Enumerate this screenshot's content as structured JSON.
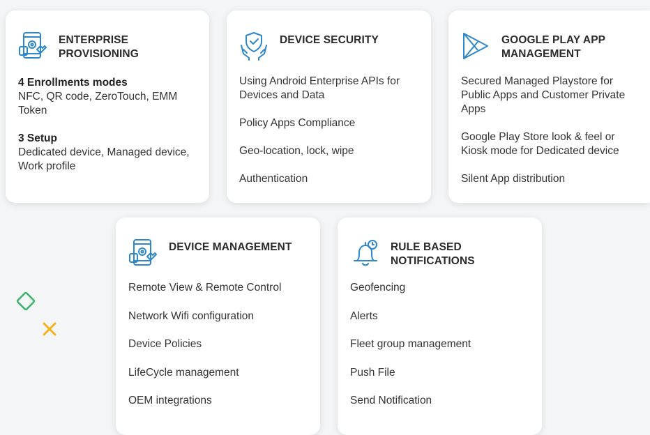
{
  "cards": {
    "enterprise": {
      "title_line1": "ENTERPRISE",
      "title_line2": "PROVISIONING",
      "groups": [
        {
          "title": "4 Enrollments modes",
          "line1": "NFC, QR code, ZeroTouch, EMM",
          "line2": "Token"
        },
        {
          "title": "3 Setup",
          "line1": "Dedicated device, Managed device,",
          "line2": "Work profile"
        }
      ]
    },
    "security": {
      "title": "DEVICE SECURITY",
      "items": [
        {
          "line1": "Using Android Enterprise APIs for",
          "line2": "Devices and Data"
        },
        {
          "line1": "Policy Apps Compliance"
        },
        {
          "line1": "Geo-location, lock, wipe"
        },
        {
          "line1": "Authentication"
        }
      ]
    },
    "playstore": {
      "title_line1": "GOOGLE PLAY APP",
      "title_line2": "MANAGEMENT",
      "items": [
        {
          "line1": "Secured Managed Playstore for",
          "line2": "Public Apps and Customer Private",
          "line3": "Apps"
        },
        {
          "line1": "Google Play Store look & feel or",
          "line2": "Kiosk mode for Dedicated device"
        },
        {
          "line1": "Silent App distribution"
        }
      ]
    },
    "management": {
      "title": "DEVICE MANAGEMENT",
      "items": [
        "Remote View & Remote Control",
        "Network Wifi configuration",
        "Device Policies",
        "LifeCycle management",
        "OEM integrations"
      ]
    },
    "notifications": {
      "title_line1": "RULE BASED",
      "title_line2": "NOTIFICATIONS",
      "items": [
        "Geofencing",
        "Alerts",
        "Fleet group management",
        "Push File",
        "Send Notification"
      ]
    }
  },
  "icons": {
    "enterprise": "device-settings-icon",
    "security": "shield-hands-icon",
    "playstore": "play-store-icon",
    "management": "device-settings-icon",
    "notifications": "bell-clock-icon"
  },
  "colors": {
    "icon_blue": "#2f86c9",
    "deco_green": "#3bb36a",
    "deco_yellow": "#f2b21b"
  }
}
